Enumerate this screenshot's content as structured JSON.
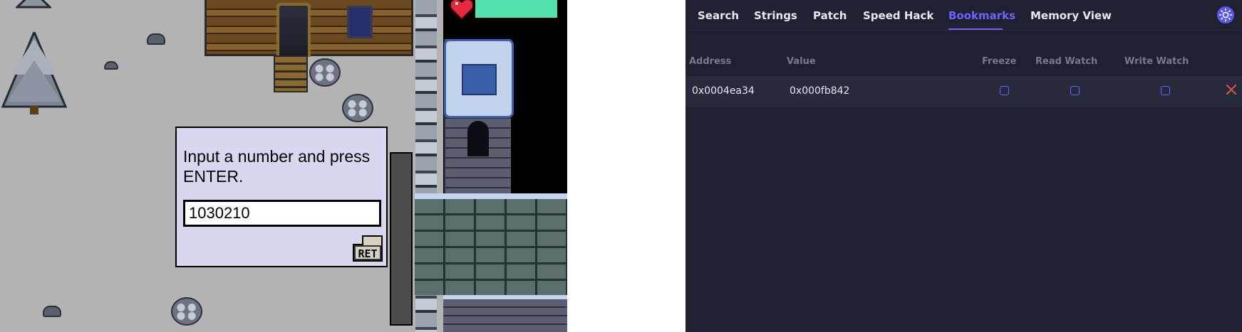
{
  "game": {
    "dialog": {
      "prompt": "Input a number and press ENTER.",
      "input_value": "1030210",
      "ret_label": "RET"
    }
  },
  "devtools": {
    "tabs": [
      "Search",
      "Strings",
      "Patch",
      "Speed Hack",
      "Bookmarks",
      "Memory View"
    ],
    "active_tab": "Bookmarks",
    "columns": {
      "address": "Address",
      "value": "Value",
      "freeze": "Freeze",
      "read_watch": "Read Watch",
      "write_watch": "Write Watch"
    },
    "bookmarks": [
      {
        "address": "0x0004ea34",
        "value": "0x000fb842",
        "freeze": false,
        "read_watch": false,
        "write_watch": false
      }
    ],
    "icons": {
      "theme": "sun-icon",
      "remove": "close-icon"
    },
    "colors": {
      "accent": "#6d63ff",
      "background": "#1f2130",
      "remove": "#e2505a"
    }
  }
}
